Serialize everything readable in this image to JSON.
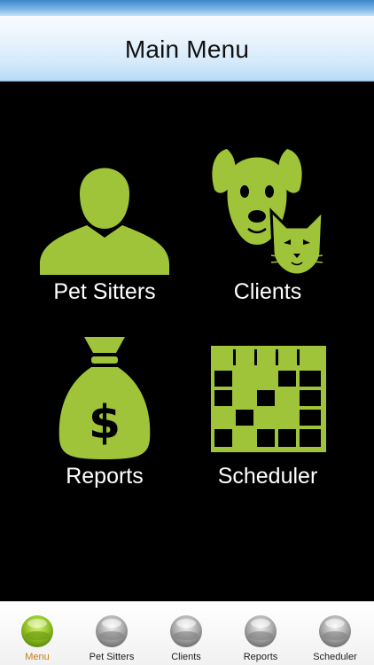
{
  "header": {
    "title": "Main Menu"
  },
  "menu": {
    "pet_sitters": "Pet Sitters",
    "clients": "Clients",
    "reports": "Reports",
    "scheduler": "Scheduler"
  },
  "tabs": [
    {
      "label": "Menu",
      "active": true
    },
    {
      "label": "Pet Sitters"
    },
    {
      "label": "Clients"
    },
    {
      "label": "Reports"
    },
    {
      "label": "Scheduler"
    }
  ],
  "colors": {
    "icon_green": "#9fc43a",
    "active_tab": "#c87a18",
    "header_blue": "#b9daf6"
  },
  "icons": {
    "pet_sitters": "person-icon",
    "clients": "dog-cat-icon",
    "reports": "money-bag-icon",
    "scheduler": "calendar-grid-icon"
  }
}
